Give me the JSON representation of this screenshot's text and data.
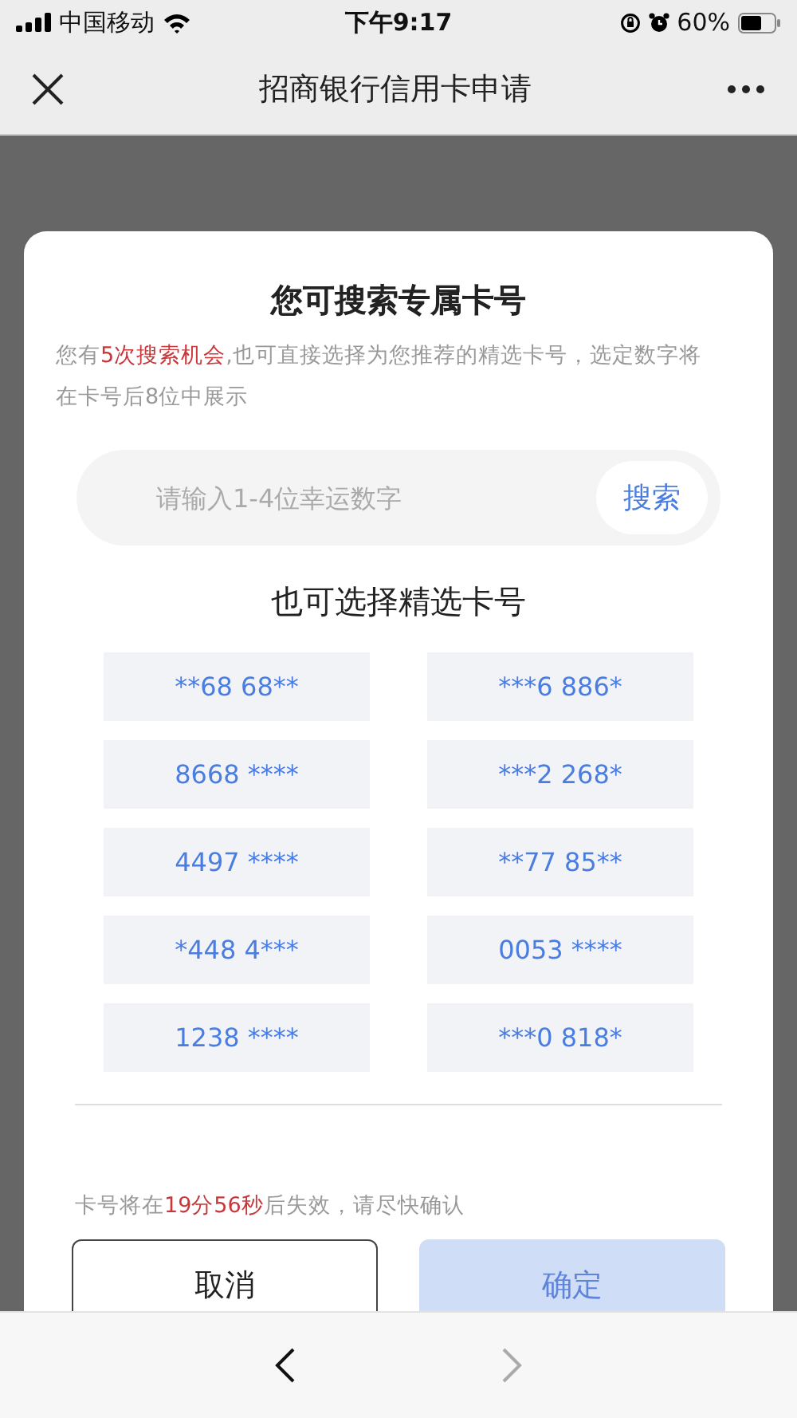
{
  "status_bar": {
    "carrier": "中国移动",
    "time": "下午9:17",
    "battery": "60%"
  },
  "nav": {
    "title": "招商银行信用卡申请"
  },
  "modal": {
    "title": "您可搜索专属卡号",
    "description": "您有**5次搜索机会**,也可直接选择为您推荐的精选卡号，选定数字将在卡号后8位中展示",
    "search": {
      "placeholder": "请输入1-4位幸运数字",
      "button": "搜索"
    },
    "section_title": "也可选择精选卡号",
    "numbers": [
      {
        "label": "**68 68**",
        "selected": false
      },
      {
        "label": "***6 886*",
        "selected": false
      },
      {
        "label": "8668 ****",
        "selected": false
      },
      {
        "label": "***2 268*",
        "selected": false
      },
      {
        "label": "4497 ****",
        "selected": false
      },
      {
        "label": "**77 85**",
        "selected": false
      },
      {
        "label": "*448 4***",
        "selected": false
      },
      {
        "label": "0053 ****",
        "selected": false
      },
      {
        "label": "1238 ****",
        "selected": false
      },
      {
        "label": "***0 818*",
        "selected": false
      }
    ],
    "timer": "卡号将在**19分56秒**后失效，请尽快确认",
    "cancel": {
      "label": "取消",
      "disabled": false
    },
    "confirm": {
      "label": "确定",
      "disabled": true
    }
  }
}
